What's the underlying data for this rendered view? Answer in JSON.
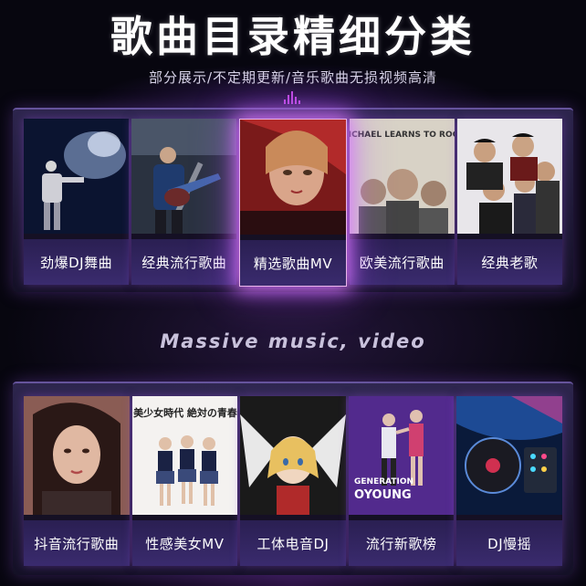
{
  "header": {
    "title": "歌曲目录精细分类",
    "subtitle": "部分展示/不定期更新/音乐歌曲无损视频高清"
  },
  "tagline": "Massive music, video",
  "row1": [
    {
      "label": "劲爆DJ舞曲",
      "icon": "dj-performer-image"
    },
    {
      "label": "经典流行歌曲",
      "icon": "guitarist-image"
    },
    {
      "label": "精选歌曲MV",
      "icon": "singer-portrait-image"
    },
    {
      "label": "欧美流行歌曲",
      "icon": "band-album-image"
    },
    {
      "label": "经典老歌",
      "icon": "group-photo-image"
    }
  ],
  "row2": [
    {
      "label": "抖音流行歌曲",
      "icon": "woman-portrait-image"
    },
    {
      "label": "性感美女MV",
      "icon": "girl-group-image"
    },
    {
      "label": "工体电音DJ",
      "icon": "anime-character-image"
    },
    {
      "label": "流行新歌榜",
      "icon": "dancers-image"
    },
    {
      "label": "DJ慢摇",
      "icon": "dj-turntable-image"
    }
  ],
  "thumb_text": {
    "band_cover": "MICHAEL LEARNS TO ROCK",
    "girl_group_cover": "美少女時代 絶対の青春",
    "generation_text": "GENERATION",
    "oyoung_text": "OYOUNG"
  },
  "colors": {
    "accent_glow": "#c14be0",
    "label_bg": "#3a2b6e",
    "page_bg": "#07060f"
  }
}
